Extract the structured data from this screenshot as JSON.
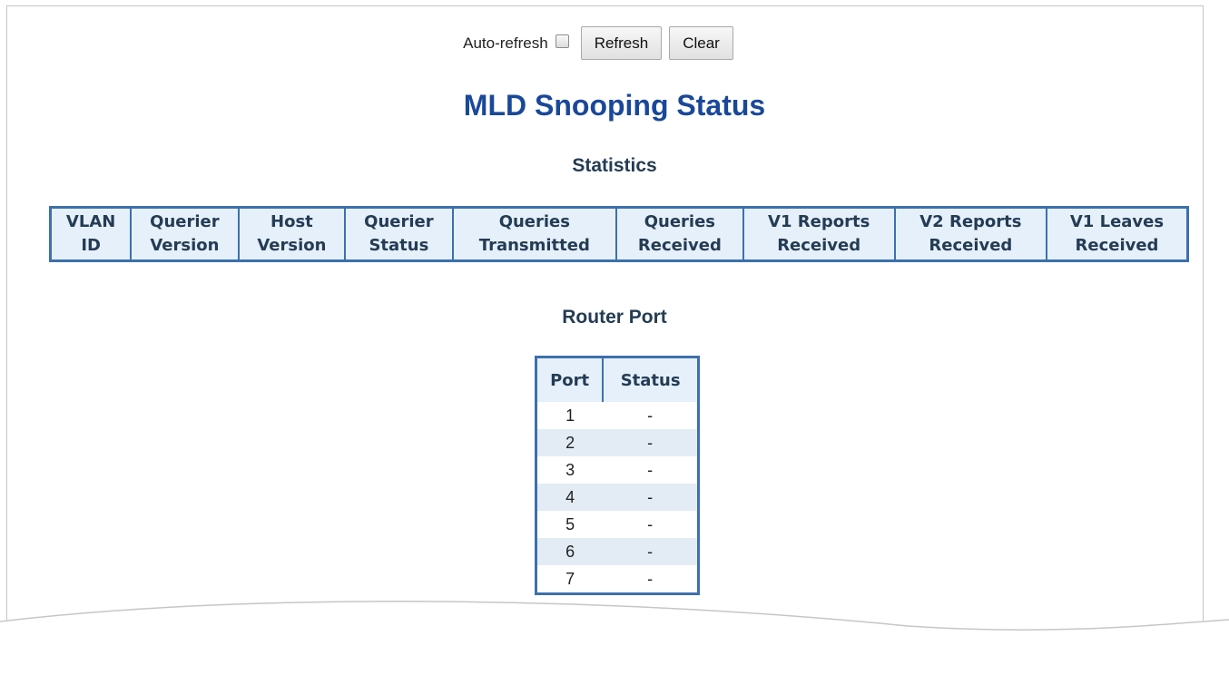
{
  "toolbar": {
    "auto_refresh_label": "Auto-refresh",
    "auto_refresh_checked": false,
    "refresh_label": "Refresh",
    "clear_label": "Clear"
  },
  "page_title": "MLD Snooping Status",
  "statistics": {
    "heading": "Statistics",
    "columns": [
      [
        "VLAN",
        "ID"
      ],
      [
        "Querier",
        "Version"
      ],
      [
        "Host",
        "Version"
      ],
      [
        "Querier",
        "Status"
      ],
      [
        "Queries",
        "Transmitted"
      ],
      [
        "Queries",
        "Received"
      ],
      [
        "V1 Reports",
        "Received"
      ],
      [
        "V2 Reports",
        "Received"
      ],
      [
        "V1 Leaves",
        "Received"
      ]
    ]
  },
  "router_port": {
    "heading": "Router Port",
    "columns": [
      "Port",
      "Status"
    ],
    "rows": [
      {
        "port": "1",
        "status": "-"
      },
      {
        "port": "2",
        "status": "-"
      },
      {
        "port": "3",
        "status": "-"
      },
      {
        "port": "4",
        "status": "-"
      },
      {
        "port": "5",
        "status": "-"
      },
      {
        "port": "6",
        "status": "-"
      },
      {
        "port": "7",
        "status": "-"
      }
    ]
  },
  "colors": {
    "title": "#1a4899",
    "table_border": "#3d70ad",
    "header_bg": "#e6f0fb",
    "stripe_bg": "#e3ecf5"
  }
}
